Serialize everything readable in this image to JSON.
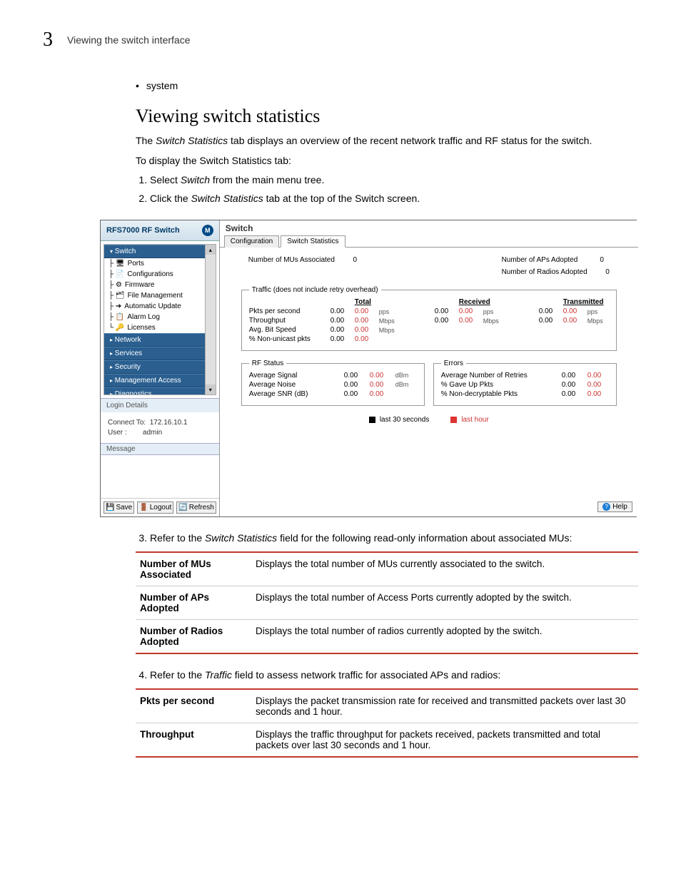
{
  "page": {
    "number": "3",
    "header": "Viewing the switch interface"
  },
  "bullet": "system",
  "section_title": "Viewing switch statistics",
  "intro_pre": "The ",
  "intro_em": "Switch Statistics",
  "intro_post": " tab displays an overview of the recent network traffic and RF status for the switch.",
  "lead": "To display the Switch Statistics tab:",
  "step1_a": "Select ",
  "step1_em": "Switch",
  "step1_b": " from the main menu tree.",
  "step2_a": "Click the ",
  "step2_em": "Switch Statistics",
  "step2_b": " tab at the top of the Switch screen.",
  "shot": {
    "product": "RFS7000 RF Switch",
    "logo": "M",
    "nav": {
      "switch": "Switch",
      "items": [
        "Ports",
        "Configurations",
        "Firmware",
        "File Management",
        "Automatic Update",
        "Alarm Log",
        "Licenses"
      ],
      "sections": [
        "Network",
        "Services",
        "Security",
        "Management Access",
        "Diagnostics"
      ]
    },
    "login": {
      "header": "Login Details",
      "connect_label": "Connect To:",
      "connect_value": "172.16.10.1",
      "user_label": "User :",
      "user_value": "admin"
    },
    "msg_label": "Message",
    "buttons": {
      "save": "Save",
      "logout": "Logout",
      "refresh": "Refresh"
    },
    "main_title": "Switch",
    "tabs": {
      "config": "Configuration",
      "stats": "Switch Statistics"
    },
    "top": {
      "mus_label": "Number of MUs Associated",
      "mus_val": "0",
      "aps_label": "Number of APs Adopted",
      "aps_val": "0",
      "radios_label": "Number of Radios Adopted",
      "radios_val": "0"
    },
    "traffic": {
      "legend": "Traffic (does not include retry overhead)",
      "col_total": "Total",
      "col_recv": "Received",
      "col_tx": "Transmitted",
      "rows": {
        "pps": {
          "label": "Pkts per second",
          "t1": "0.00",
          "t2": "0.00",
          "tu": "pps",
          "r1": "0.00",
          "r2": "0.00",
          "ru": "pps",
          "x1": "0.00",
          "x2": "0.00",
          "xu": "pps"
        },
        "tp": {
          "label": "Throughput",
          "t1": "0.00",
          "t2": "0.00",
          "tu": "Mbps",
          "r1": "0.00",
          "r2": "0.00",
          "ru": "Mbps",
          "x1": "0.00",
          "x2": "0.00",
          "xu": "Mbps"
        },
        "abs": {
          "label": "Avg. Bit Speed",
          "t1": "0.00",
          "t2": "0.00",
          "tu": "Mbps"
        },
        "nuc": {
          "label": "% Non-unicast pkts",
          "t1": "0.00",
          "t2": "0.00"
        }
      }
    },
    "rf": {
      "legend": "RF Status",
      "sig": {
        "label": "Average Signal",
        "a": "0.00",
        "b": "0.00",
        "u": "dBm"
      },
      "noi": {
        "label": "Average Noise",
        "a": "0.00",
        "b": "0.00",
        "u": "dBm"
      },
      "snr": {
        "label": "Average SNR (dB)",
        "a": "0.00",
        "b": "0.00"
      }
    },
    "err": {
      "legend": "Errors",
      "ret": {
        "label": "Average Number of Retries",
        "a": "0.00",
        "b": "0.00"
      },
      "gup": {
        "label": "% Gave Up Pkts",
        "a": "0.00",
        "b": "0.00"
      },
      "ndc": {
        "label": "% Non-decryptable Pkts",
        "a": "0.00",
        "b": "0.00"
      }
    },
    "legend30": "last 30 seconds",
    "legendHr": "last hour",
    "help": "Help"
  },
  "step3_a": "Refer to the ",
  "step3_em": "Switch Statistics",
  "step3_b": " field for the following read-only information about associated MUs:",
  "table1": {
    "r1k": "Number of MUs Associated",
    "r1v": "Displays the total number of MUs currently associated to the switch.",
    "r2k": "Number of APs Adopted",
    "r2v": "Displays the total number of Access Ports currently adopted by the switch.",
    "r3k": "Number of Radios Adopted",
    "r3v": "Displays the total number of radios currently adopted by the switch."
  },
  "step4_a": "Refer to the ",
  "step4_em": "Traffic",
  "step4_b": " field to assess network traffic for associated APs and radios:",
  "table2": {
    "r1k": "Pkts per second",
    "r1v": "Displays the packet transmission rate for received and transmitted packets over last 30 seconds and 1 hour.",
    "r2k": "Throughput",
    "r2v": "Displays the traffic throughput for packets received, packets transmitted and total packets over last 30 seconds and 1 hour."
  }
}
